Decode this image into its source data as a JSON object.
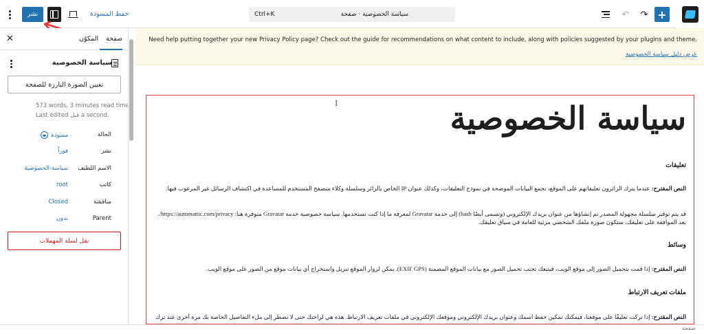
{
  "toolbar": {
    "publish_label": "نشر",
    "save_draft_label": "حفظ المسودة",
    "command_title": "سياسة الخصوصية · صفحة",
    "command_shortcut": "Ctrl+K",
    "icons": [
      "options-icon",
      "settings-icon",
      "view-icon",
      "document-overview-icon",
      "undo-icon",
      "redo-icon",
      "block-inserter-icon",
      "site-logo-icon"
    ]
  },
  "sidebar": {
    "tabs": {
      "page": "صفحة",
      "block": "المكوّن"
    },
    "title": "سياسة الخصوصية",
    "featured_image_label": "تعيين الصورة البارزة للصفحة",
    "meta_words": "573 words, 3 minutes read time.",
    "meta_edited": "Last edited قبل a second.",
    "rows": [
      {
        "label": "الحالة",
        "value": "مسودة"
      },
      {
        "label": "نشر",
        "value": "فوراً"
      },
      {
        "label": "الاسم اللطيف",
        "value": "سياسة-الخصوصية"
      },
      {
        "label": "كاتب",
        "value": "root"
      },
      {
        "label": "مناقشة",
        "value": "Closed"
      },
      {
        "label": "Parent",
        "value": "بدون"
      }
    ],
    "trash_label": "نقل لسلة المهملات"
  },
  "notice": {
    "text": "Need help putting together your new Privacy Policy page? Check out the guide for recommendations on what content to include, along with policies suggested by your plugins and theme.",
    "link_label": "عرض دليل سياسة الخصوصية"
  },
  "editor": {
    "post_title": "سياسة الخصوصية",
    "h_comments": "تعليقات",
    "suggested_label": "النص المقترح:",
    "p_comments_1": "عندما يترك الزائرون تعليقاتهم على الموقع، نجمع البيانات الموضحة في نموذج التعليقات، وكذلك عنوان IP الخاص بالزائر وسلسلة وكلاء متصفح المستخدم للمساعدة في اكتشاف الرسائل غير المرغوب فيها.",
    "p_comments_2": "قد يتم توفير سلسلة مجهولة المصدر تم إنشاؤها من عنوان بريدك الإلكتروني (وتسمى أيضًا hash) إلى خدمة Gravatar لمعرفة ما إذا كنت تستخدمها. سياسة خصوصية خدمة Gravatar متوفرة هنا: https://automattic.com/privacy/. بعد الموافقة على تعليقك، ستكون صورة ملفك الشخصي مرئية للعامة في سياق تعليقك.",
    "h_media": "وسائط",
    "p_media": "إذا قمت بتحميل الصور إلى موقع الويب، فيتبعك تجنب تحميل الصور مع بيانات الموقع المضمنة (EXIF GPS). يمكن لزوار الموقع تنزيل واستخراج أي بيانات موقع من الصور على موقع الويب.",
    "h_cookies": "ملفات تعريف الارتباط",
    "p_cookies": "إذا تركت تعليقًا على موقعنا، فيمكنك تمكين حفظ اسمك وعنوان بريدك الإلكتروني وموقعك الإلكتروني في ملفات تعريف الارتباط. هذه هي لراحتك حتى لا تضطر إلى ملء التفاصيل الخاصة بك مرة أخرى عند ترك"
  },
  "footer": {
    "breadcrumb": "صفحة"
  }
}
